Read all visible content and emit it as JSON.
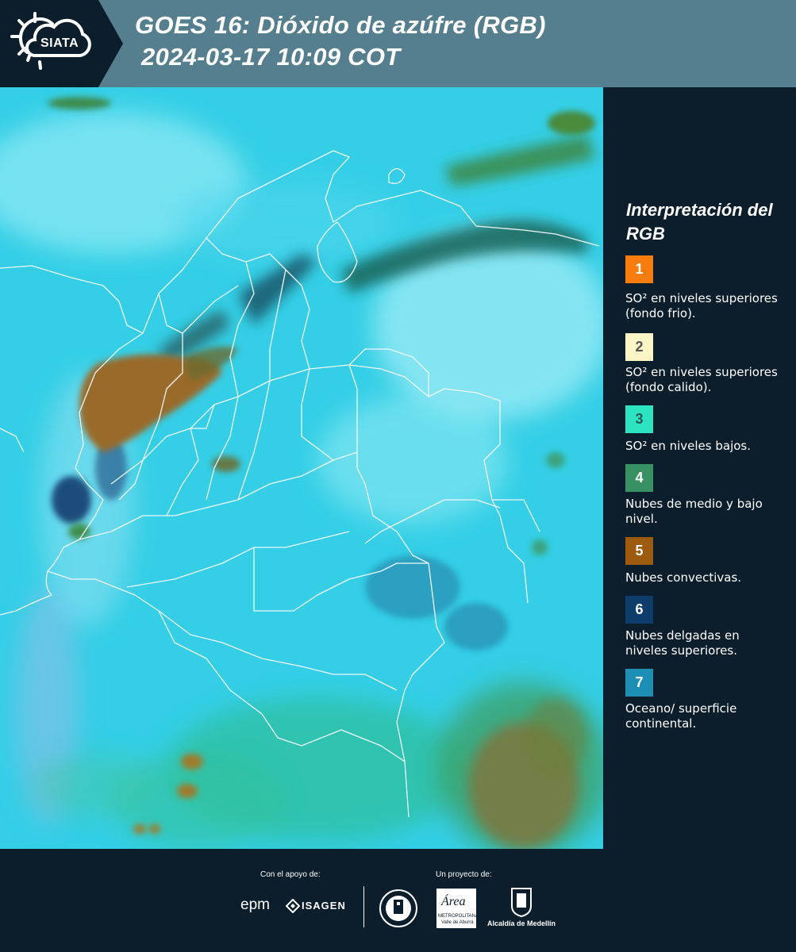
{
  "header": {
    "logo_text": "SIATA",
    "title_line1": "GOES 16: Dióxido de azúfre (RGB)",
    "title_line2": "2024-03-17 10:09 COT"
  },
  "legend": {
    "title": "Interpretación del RGB",
    "items": [
      {
        "number": "1",
        "color": "#f97d0d",
        "text_color": "#ffffff",
        "label": "SO² en niveles superiores (fondo frio)."
      },
      {
        "number": "2",
        "color": "#fbf5c8",
        "text_color": "#555555",
        "label": "SO² en niveles superiores (fondo calido)."
      },
      {
        "number": "3",
        "color": "#2ce4c1",
        "text_color": "#2b5a58",
        "label": "SO² en niveles bajos."
      },
      {
        "number": "4",
        "color": "#379163",
        "text_color": "#ffffff",
        "label": "Nubes de medio y bajo nivel."
      },
      {
        "number": "5",
        "color": "#9c5b0e",
        "text_color": "#ffffff",
        "label": "Nubes convectivas."
      },
      {
        "number": "6",
        "color": "#0c3d6b",
        "text_color": "#ffffff",
        "label": "Nubes delgadas en niveles superiores."
      },
      {
        "number": "7",
        "color": "#1d8fb5",
        "text_color": "#ffffff",
        "label": "Oceano/ superficie continental."
      }
    ]
  },
  "footer": {
    "support_label": "Con el apoyo de:",
    "project_label": "Un proyecto de:",
    "epm_logo": "epm",
    "isagen_logo": "ISAGEN",
    "area_logo": "Área",
    "area_sub": "METROPOLITANA",
    "area_sub2": "Valle de Aburrá",
    "alcaldia_logo": "Alcaldía de Medellín"
  }
}
